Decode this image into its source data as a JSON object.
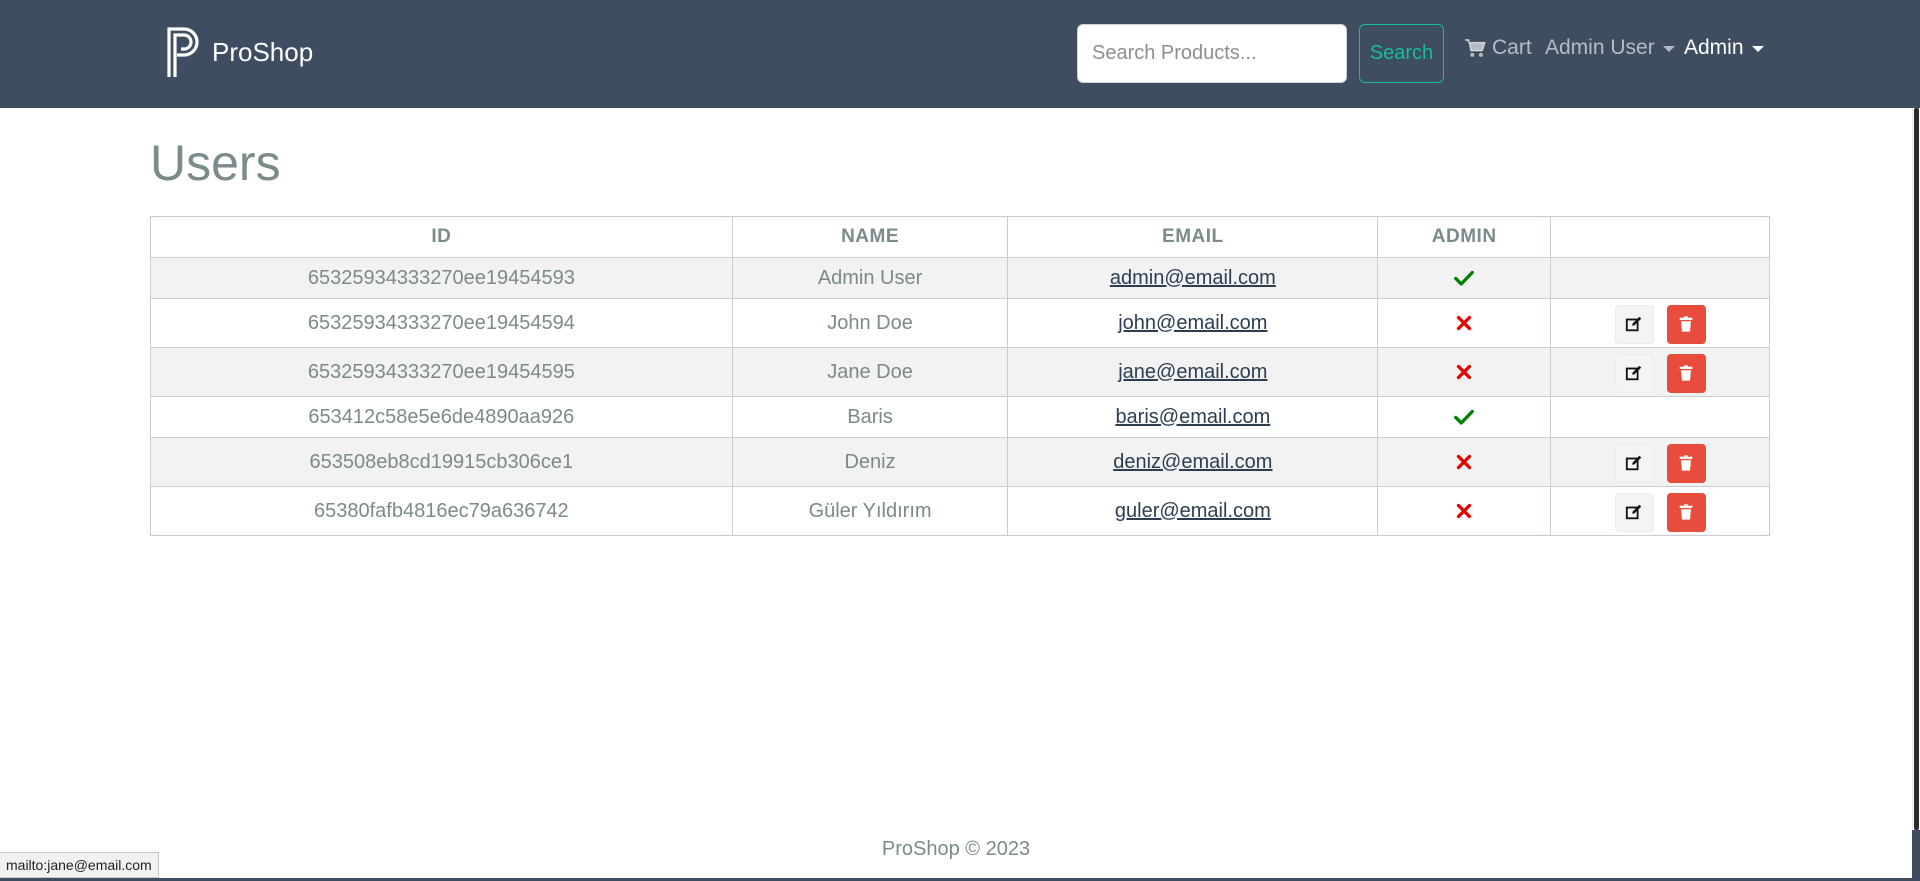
{
  "colors": {
    "navbar": "#3e4d5f",
    "accent": "#18bc9c",
    "danger": "#e74c3c",
    "success": "#008000",
    "error": "#e60000",
    "text": "#7b8a8b",
    "link": "#2c3e50"
  },
  "navbar": {
    "brand": "ProShop",
    "search_placeholder": "Search Products...",
    "search_button": "Search",
    "cart_label": "Cart",
    "cart_icon": "shopping-cart-icon",
    "user_menu": "Admin User",
    "admin_menu": "Admin"
  },
  "page": {
    "title": "Users"
  },
  "table": {
    "headers": {
      "id": "ID",
      "name": "NAME",
      "email": "EMAIL",
      "admin": "ADMIN",
      "actions": ""
    },
    "rows": [
      {
        "id": "65325934333270ee19454593",
        "name": "Admin User",
        "email": "admin@email.com",
        "is_admin": true
      },
      {
        "id": "65325934333270ee19454594",
        "name": "John Doe",
        "email": "john@email.com",
        "is_admin": false
      },
      {
        "id": "65325934333270ee19454595",
        "name": "Jane Doe",
        "email": "jane@email.com",
        "is_admin": false
      },
      {
        "id": "653412c58e5e6de4890aa926",
        "name": "Baris",
        "email": "baris@email.com",
        "is_admin": true
      },
      {
        "id": "653508eb8cd19915cb306ce1",
        "name": "Deniz",
        "email": "deniz@email.com",
        "is_admin": false
      },
      {
        "id": "65380fafb4816ec79a636742",
        "name": "Güler Yıldırım",
        "email": "guler@email.com",
        "is_admin": false
      }
    ]
  },
  "footer": {
    "text": "ProShop © 2023"
  },
  "status_bar": {
    "text": "mailto:jane@email.com"
  }
}
